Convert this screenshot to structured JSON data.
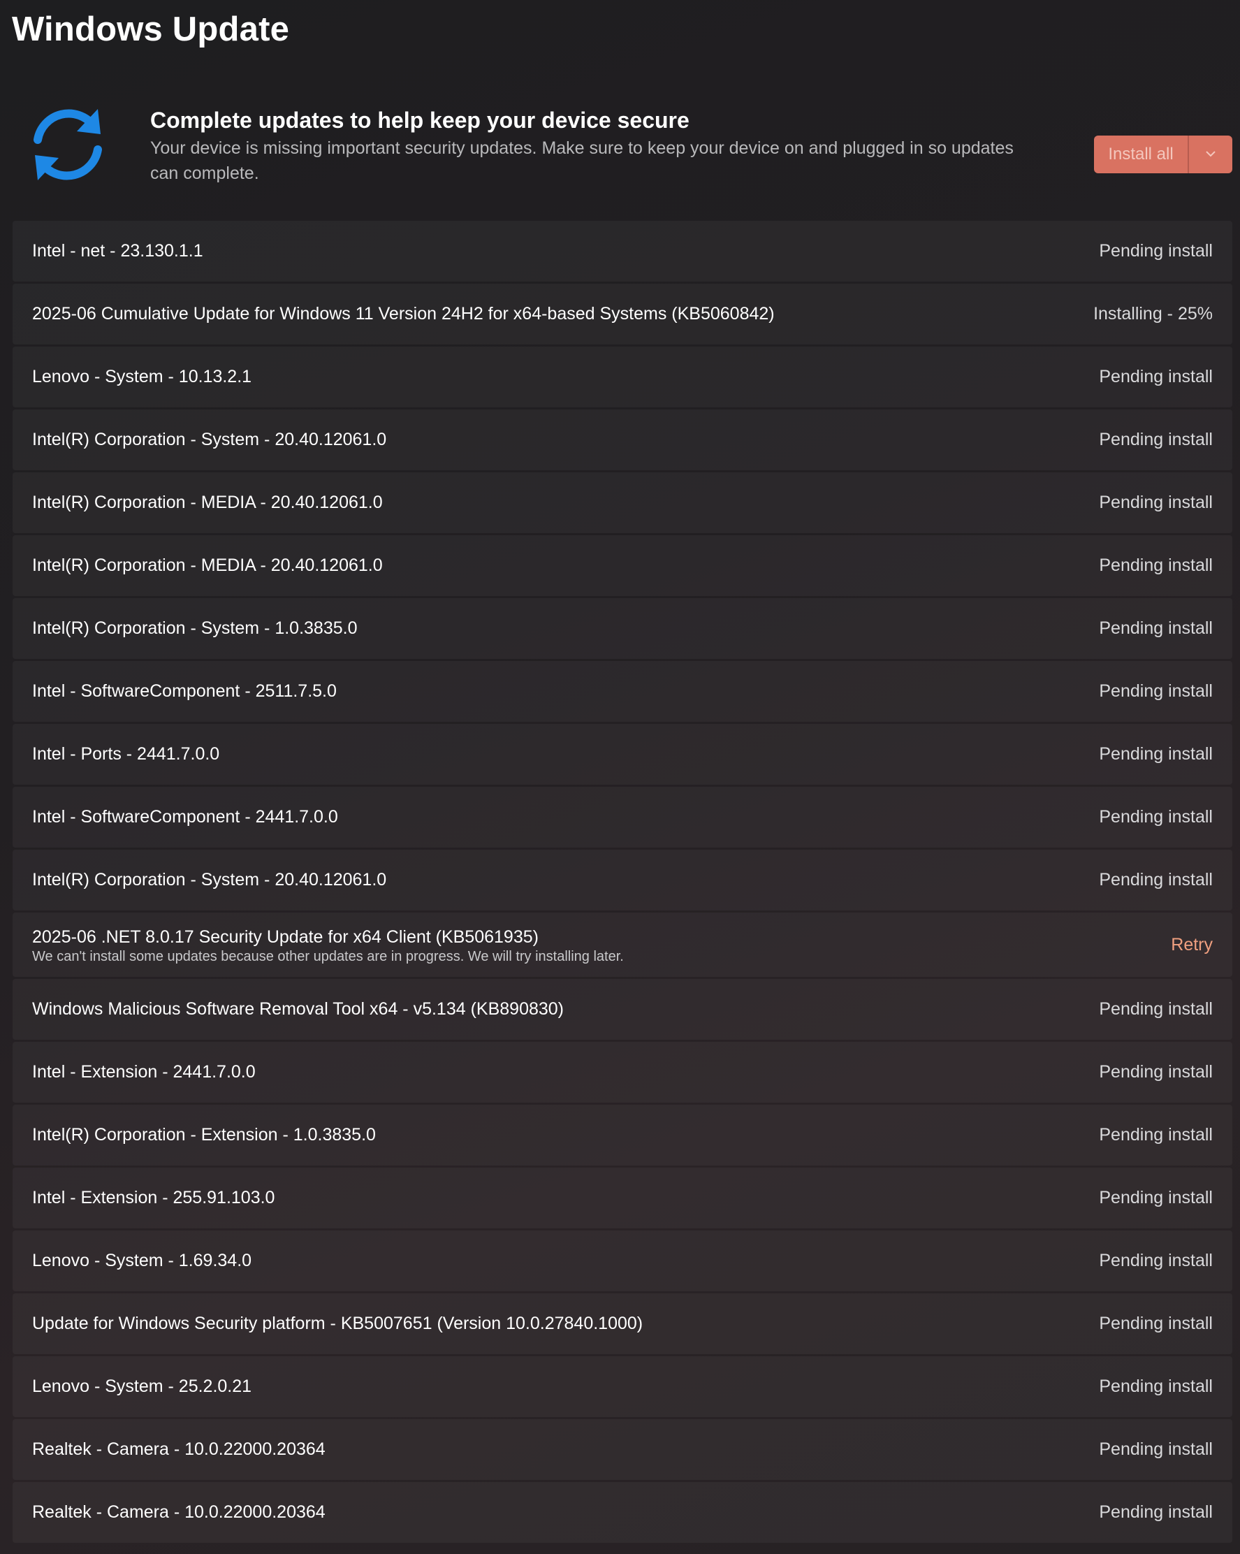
{
  "page": {
    "title": "Windows Update"
  },
  "hero": {
    "icon": "sync-icon",
    "title": "Complete updates to help keep your device secure",
    "description": "Your device is missing important security updates. Make sure to keep your device on and plugged in so updates can complete.",
    "install_all_label": "Install all",
    "dropdown_icon": "chevron-down-icon",
    "accent_color": "#d97261",
    "icon_color": "#1e88e5"
  },
  "updates": [
    {
      "name": "Intel - net - 23.130.1.1",
      "status": "Pending install"
    },
    {
      "name": "2025-06 Cumulative Update for Windows 11 Version 24H2 for x64-based Systems (KB5060842)",
      "status": "Installing - 25%"
    },
    {
      "name": "Lenovo - System - 10.13.2.1",
      "status": "Pending install"
    },
    {
      "name": "Intel(R) Corporation - System - 20.40.12061.0",
      "status": "Pending install"
    },
    {
      "name": "Intel(R) Corporation - MEDIA - 20.40.12061.0",
      "status": "Pending install"
    },
    {
      "name": "Intel(R) Corporation - MEDIA - 20.40.12061.0",
      "status": "Pending install"
    },
    {
      "name": "Intel(R) Corporation - System - 1.0.3835.0",
      "status": "Pending install"
    },
    {
      "name": "Intel - SoftwareComponent - 2511.7.5.0",
      "status": "Pending install"
    },
    {
      "name": "Intel - Ports - 2441.7.0.0",
      "status": "Pending install"
    },
    {
      "name": "Intel - SoftwareComponent - 2441.7.0.0",
      "status": "Pending install"
    },
    {
      "name": "Intel(R) Corporation - System - 20.40.12061.0",
      "status": "Pending install"
    },
    {
      "name": "2025-06 .NET 8.0.17 Security Update for x64 Client (KB5061935)",
      "subtext": "We can't install some updates because other updates are in progress. We will try installing later.",
      "status": "Retry"
    },
    {
      "name": "Windows Malicious Software Removal Tool x64 - v5.134 (KB890830)",
      "status": "Pending install"
    },
    {
      "name": "Intel - Extension - 2441.7.0.0",
      "status": "Pending install"
    },
    {
      "name": "Intel(R) Corporation - Extension - 1.0.3835.0",
      "status": "Pending install"
    },
    {
      "name": "Intel - Extension - 255.91.103.0",
      "status": "Pending install"
    },
    {
      "name": "Lenovo - System - 1.69.34.0",
      "status": "Pending install"
    },
    {
      "name": "Update for Windows Security platform - KB5007651 (Version 10.0.27840.1000)",
      "status": "Pending install"
    },
    {
      "name": "Lenovo - System - 25.2.0.21",
      "status": "Pending install"
    },
    {
      "name": "Realtek - Camera - 10.0.22000.20364",
      "status": "Pending install"
    },
    {
      "name": "Realtek - Camera - 10.0.22000.20364",
      "status": "Pending install"
    }
  ]
}
